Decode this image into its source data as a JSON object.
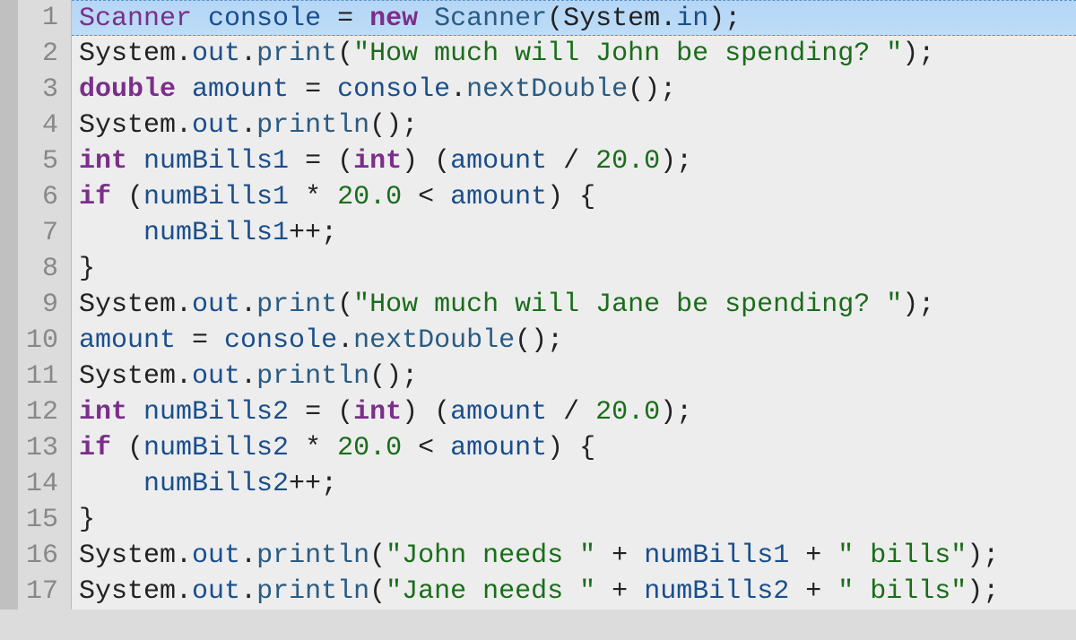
{
  "editor": {
    "lines": [
      {
        "num": "1",
        "hl": true,
        "tokens": [
          {
            "t": "Scanner",
            "c": "type"
          },
          {
            "t": " ",
            "c": "default"
          },
          {
            "t": "console",
            "c": "ident"
          },
          {
            "t": " = ",
            "c": "default"
          },
          {
            "t": "new",
            "c": "kw"
          },
          {
            "t": " ",
            "c": "default"
          },
          {
            "t": "Scanner",
            "c": "method"
          },
          {
            "t": "(",
            "c": "default"
          },
          {
            "t": "System",
            "c": "class"
          },
          {
            "t": ".",
            "c": "default"
          },
          {
            "t": "in",
            "c": "field"
          },
          {
            "t": ");",
            "c": "default"
          }
        ]
      },
      {
        "num": "2",
        "hl": false,
        "tokens": [
          {
            "t": "System",
            "c": "class"
          },
          {
            "t": ".",
            "c": "default"
          },
          {
            "t": "out",
            "c": "field"
          },
          {
            "t": ".",
            "c": "default"
          },
          {
            "t": "print",
            "c": "method"
          },
          {
            "t": "(",
            "c": "default"
          },
          {
            "t": "\"How much will John be spending? \"",
            "c": "string"
          },
          {
            "t": ");",
            "c": "default"
          }
        ]
      },
      {
        "num": "3",
        "hl": false,
        "tokens": [
          {
            "t": "double",
            "c": "kw"
          },
          {
            "t": " ",
            "c": "default"
          },
          {
            "t": "amount",
            "c": "ident"
          },
          {
            "t": " = ",
            "c": "default"
          },
          {
            "t": "console",
            "c": "ident"
          },
          {
            "t": ".",
            "c": "default"
          },
          {
            "t": "nextDouble",
            "c": "method"
          },
          {
            "t": "();",
            "c": "default"
          }
        ]
      },
      {
        "num": "4",
        "hl": false,
        "tokens": [
          {
            "t": "System",
            "c": "class"
          },
          {
            "t": ".",
            "c": "default"
          },
          {
            "t": "out",
            "c": "field"
          },
          {
            "t": ".",
            "c": "default"
          },
          {
            "t": "println",
            "c": "method"
          },
          {
            "t": "();",
            "c": "default"
          }
        ]
      },
      {
        "num": "5",
        "hl": false,
        "tokens": [
          {
            "t": "int",
            "c": "kw"
          },
          {
            "t": " ",
            "c": "default"
          },
          {
            "t": "numBills1",
            "c": "ident"
          },
          {
            "t": " = (",
            "c": "default"
          },
          {
            "t": "int",
            "c": "kw"
          },
          {
            "t": ") (",
            "c": "default"
          },
          {
            "t": "amount",
            "c": "ident"
          },
          {
            "t": " / ",
            "c": "default"
          },
          {
            "t": "20.0",
            "c": "num"
          },
          {
            "t": ");",
            "c": "default"
          }
        ]
      },
      {
        "num": "6",
        "hl": false,
        "tokens": [
          {
            "t": "if",
            "c": "kw"
          },
          {
            "t": " (",
            "c": "default"
          },
          {
            "t": "numBills1",
            "c": "ident"
          },
          {
            "t": " * ",
            "c": "default"
          },
          {
            "t": "20.0",
            "c": "num"
          },
          {
            "t": " < ",
            "c": "default"
          },
          {
            "t": "amount",
            "c": "ident"
          },
          {
            "t": ") {",
            "c": "default"
          }
        ]
      },
      {
        "num": "7",
        "hl": false,
        "tokens": [
          {
            "t": "    ",
            "c": "default"
          },
          {
            "t": "numBills1",
            "c": "ident"
          },
          {
            "t": "++;",
            "c": "default"
          }
        ]
      },
      {
        "num": "8",
        "hl": false,
        "tokens": [
          {
            "t": "}",
            "c": "default"
          }
        ]
      },
      {
        "num": "9",
        "hl": false,
        "tokens": [
          {
            "t": "System",
            "c": "class"
          },
          {
            "t": ".",
            "c": "default"
          },
          {
            "t": "out",
            "c": "field"
          },
          {
            "t": ".",
            "c": "default"
          },
          {
            "t": "print",
            "c": "method"
          },
          {
            "t": "(",
            "c": "default"
          },
          {
            "t": "\"How much will Jane be spending? \"",
            "c": "string"
          },
          {
            "t": ");",
            "c": "default"
          }
        ]
      },
      {
        "num": "10",
        "hl": false,
        "tokens": [
          {
            "t": "amount",
            "c": "ident"
          },
          {
            "t": " = ",
            "c": "default"
          },
          {
            "t": "console",
            "c": "ident"
          },
          {
            "t": ".",
            "c": "default"
          },
          {
            "t": "nextDouble",
            "c": "method"
          },
          {
            "t": "();",
            "c": "default"
          }
        ]
      },
      {
        "num": "11",
        "hl": false,
        "tokens": [
          {
            "t": "System",
            "c": "class"
          },
          {
            "t": ".",
            "c": "default"
          },
          {
            "t": "out",
            "c": "field"
          },
          {
            "t": ".",
            "c": "default"
          },
          {
            "t": "println",
            "c": "method"
          },
          {
            "t": "();",
            "c": "default"
          }
        ]
      },
      {
        "num": "12",
        "hl": false,
        "tokens": [
          {
            "t": "int",
            "c": "kw"
          },
          {
            "t": " ",
            "c": "default"
          },
          {
            "t": "numBills2",
            "c": "ident"
          },
          {
            "t": " = (",
            "c": "default"
          },
          {
            "t": "int",
            "c": "kw"
          },
          {
            "t": ") (",
            "c": "default"
          },
          {
            "t": "amount",
            "c": "ident"
          },
          {
            "t": " / ",
            "c": "default"
          },
          {
            "t": "20.0",
            "c": "num"
          },
          {
            "t": ");",
            "c": "default"
          }
        ]
      },
      {
        "num": "13",
        "hl": false,
        "tokens": [
          {
            "t": "if",
            "c": "kw"
          },
          {
            "t": " (",
            "c": "default"
          },
          {
            "t": "numBills2",
            "c": "ident"
          },
          {
            "t": " * ",
            "c": "default"
          },
          {
            "t": "20.0",
            "c": "num"
          },
          {
            "t": " < ",
            "c": "default"
          },
          {
            "t": "amount",
            "c": "ident"
          },
          {
            "t": ") {",
            "c": "default"
          }
        ]
      },
      {
        "num": "14",
        "hl": false,
        "tokens": [
          {
            "t": "    ",
            "c": "default"
          },
          {
            "t": "numBills2",
            "c": "ident"
          },
          {
            "t": "++;",
            "c": "default"
          }
        ]
      },
      {
        "num": "15",
        "hl": false,
        "tokens": [
          {
            "t": "}",
            "c": "default"
          }
        ]
      },
      {
        "num": "16",
        "hl": false,
        "tokens": [
          {
            "t": "System",
            "c": "class"
          },
          {
            "t": ".",
            "c": "default"
          },
          {
            "t": "out",
            "c": "field"
          },
          {
            "t": ".",
            "c": "default"
          },
          {
            "t": "println",
            "c": "method"
          },
          {
            "t": "(",
            "c": "default"
          },
          {
            "t": "\"John needs \"",
            "c": "string"
          },
          {
            "t": " + ",
            "c": "default"
          },
          {
            "t": "numBills1",
            "c": "ident"
          },
          {
            "t": " + ",
            "c": "default"
          },
          {
            "t": "\" bills\"",
            "c": "string"
          },
          {
            "t": ");",
            "c": "default"
          }
        ]
      },
      {
        "num": "17",
        "hl": false,
        "tokens": [
          {
            "t": "System",
            "c": "class"
          },
          {
            "t": ".",
            "c": "default"
          },
          {
            "t": "out",
            "c": "field"
          },
          {
            "t": ".",
            "c": "default"
          },
          {
            "t": "println",
            "c": "method"
          },
          {
            "t": "(",
            "c": "default"
          },
          {
            "t": "\"Jane needs \"",
            "c": "string"
          },
          {
            "t": " + ",
            "c": "default"
          },
          {
            "t": "numBills2",
            "c": "ident"
          },
          {
            "t": " + ",
            "c": "default"
          },
          {
            "t": "\" bills\"",
            "c": "string"
          },
          {
            "t": ");",
            "c": "default"
          }
        ]
      }
    ]
  }
}
